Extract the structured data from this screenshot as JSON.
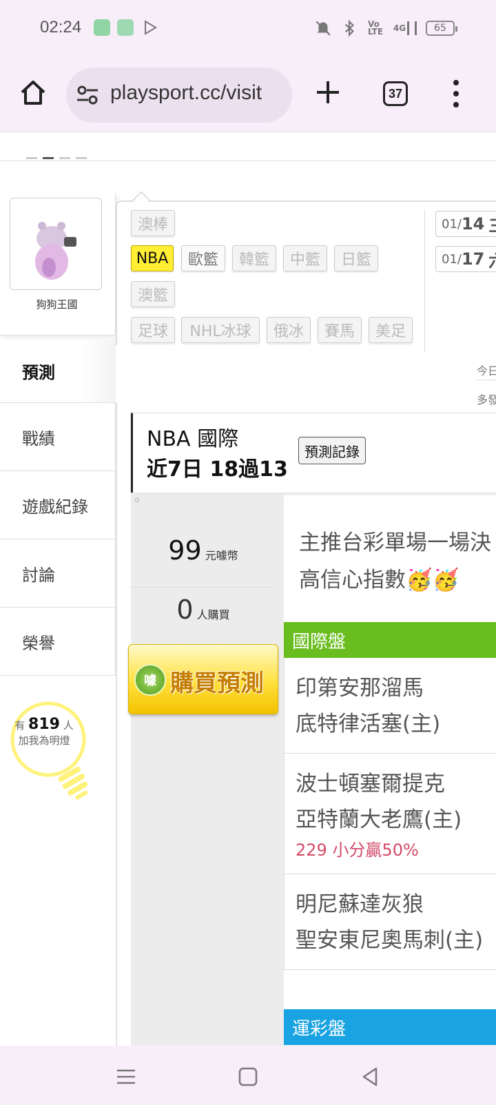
{
  "status_bar": {
    "time": "02:24",
    "icons": [
      "mute-icon",
      "bluetooth-icon",
      "volte-icon",
      "signal-4g-icon"
    ],
    "network_label": "4G",
    "battery": "65"
  },
  "browser": {
    "url": "playsport.cc/visit",
    "tab_count": "37"
  },
  "profile": {
    "username": "狗狗王國"
  },
  "left_nav": [
    {
      "label": "預測",
      "active": true
    },
    {
      "label": "戰績",
      "active": false
    },
    {
      "label": "遊戲紀錄",
      "active": false
    },
    {
      "label": "討論",
      "active": false
    },
    {
      "label": "榮譽",
      "active": false
    }
  ],
  "fans": {
    "prefix": "有",
    "count": "819",
    "suffix": "人",
    "caption": "加我為明燈"
  },
  "leagues": {
    "row0": [
      "澳棒"
    ],
    "row1": [
      "NBA",
      "歐籃",
      "韓籃",
      "中籃",
      "日籃"
    ],
    "row2": [
      "澳籃"
    ],
    "row3": [
      "足球",
      "NHL冰球",
      "俄冰",
      "賽馬",
      "美足"
    ],
    "selected": "NBA"
  },
  "dates": [
    {
      "month": "01/",
      "day": "14",
      "weekday": "三"
    },
    {
      "month": "01/",
      "day": "17",
      "weekday": "六"
    }
  ],
  "side_notes": [
    "今日",
    "多發"
  ],
  "prediction": {
    "title": "NBA 國際",
    "record": "近7日 18過13",
    "history_button": "預測記錄",
    "price": "99",
    "price_unit": "元噱幣",
    "buyers": "0",
    "buyers_unit": "人購買",
    "buy_button": "購買預測",
    "coin_label": "噱",
    "note_line1": "主推台彩單場一場決",
    "note_line2": "高信心指數🥳🥳"
  },
  "sections": {
    "intl": "國際盤",
    "sport_lottery": "運彩盤"
  },
  "games": [
    {
      "away": "印第安那溜馬",
      "home": "底特律活塞(主)",
      "pick": ""
    },
    {
      "away": "波士頓塞爾提克",
      "home": "亞特蘭大老鷹(主)",
      "pick": "229 小分贏50%"
    },
    {
      "away": "明尼蘇達灰狼",
      "home": "聖安東尼奧馬刺(主)",
      "pick": ""
    }
  ],
  "colors": {
    "intl_header": "#69bd1e",
    "sport_header": "#1aa3e2",
    "selected_chip": "#ffee33",
    "pick_text": "#d24a68"
  }
}
